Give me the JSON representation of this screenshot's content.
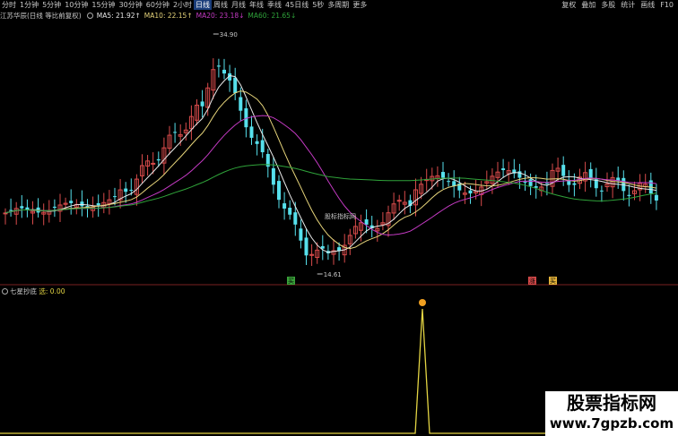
{
  "toolbar": {
    "items": [
      "分时",
      "1分钟",
      "5分钟",
      "10分钟",
      "15分钟",
      "30分钟",
      "60分钟",
      "2小时",
      "日线",
      "周线",
      "月线",
      "年线",
      "季线",
      "45日线",
      "5秒",
      "多周期",
      "更多"
    ],
    "active_index": 8,
    "right_items": [
      "复权",
      "叠加",
      "多股",
      "统计",
      "画线",
      "F10"
    ]
  },
  "main_indicator": {
    "stock_label": "江苏华辰(日线 等比前复权)",
    "ma5": "MA5: 21.92↑",
    "ma10": "MA10: 22.15↑",
    "ma20": "MA20: 23.18↓",
    "ma60": "MA60: 21.65↓"
  },
  "annotations": {
    "high": "34.90",
    "low": "14.61",
    "watermark_inside": "股标指标网",
    "signal_buy_1": "买",
    "signal_buy_2": "买",
    "signal_rise": "涨"
  },
  "sub_indicator": {
    "name": "七星抄底",
    "value": "选: 0.00"
  },
  "watermark": {
    "title": "股票指标网",
    "url": "www.7gpzb.com"
  },
  "colors": {
    "up": "#d94b4b",
    "down": "#56e0ec",
    "ma5": "#e8e8e8",
    "ma10": "#e6d47a",
    "ma20": "#c43ac3",
    "ma60": "#2fa33a",
    "sub_line": "#e3d443",
    "active_tab_bg": "#1a3d7a"
  }
}
